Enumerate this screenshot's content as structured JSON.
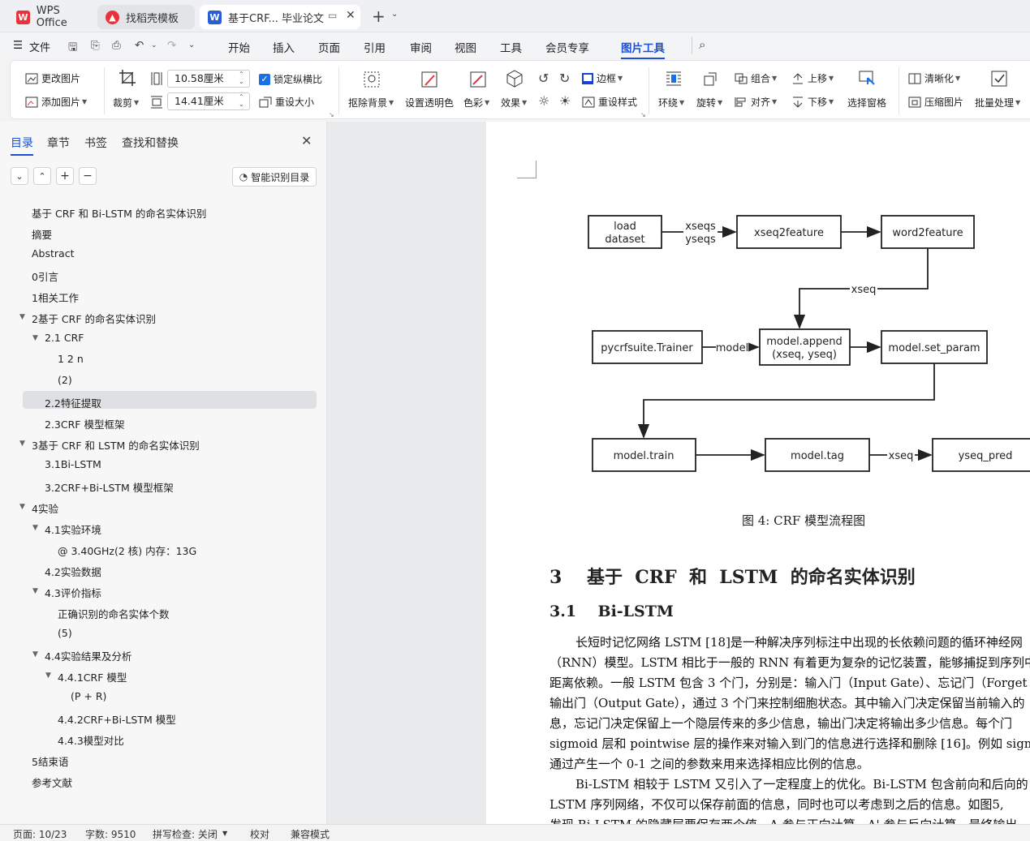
{
  "tabs": {
    "wps": "WPS Office",
    "template": "找稻壳模板",
    "doc": "基于CRF... 毕业论文"
  },
  "menu": {
    "file": "文件",
    "items": [
      "开始",
      "插入",
      "页面",
      "引用",
      "审阅",
      "视图",
      "工具",
      "会员专享",
      "图片工具"
    ]
  },
  "ribbon": {
    "change_image": "更改图片",
    "add_image": "添加图片",
    "crop": "裁剪",
    "width": "10.58厘米",
    "height": "14.41厘米",
    "lock_ratio": "锁定纵横比",
    "resize": "重设大小",
    "remove_bg": "抠除背景",
    "set_transparent": "设置透明色",
    "color": "色彩",
    "effect": "效果",
    "border": "边框",
    "reset_style": "重设样式",
    "wrap": "环绕",
    "rotate": "旋转",
    "group": "组合",
    "align": "对齐",
    "bring_up": "上移",
    "send_down": "下移",
    "select_pane": "选择窗格",
    "sharpen": "清晰化",
    "compress": "压缩图片",
    "batch": "批量处理"
  },
  "nav": {
    "tabs": [
      "目录",
      "章节",
      "书签",
      "查找和替换"
    ],
    "smart_toc": "智能识别目录",
    "items": [
      {
        "label": "基于 CRF 和 Bi-LSTM 的命名实体识别"
      },
      {
        "label": "摘要"
      },
      {
        "label": "Abstract"
      },
      {
        "label": "0引言"
      },
      {
        "label": "1相关工作"
      },
      {
        "label": "2基于 CRF 的命名实体识别"
      },
      {
        "label": "2.1 CRF"
      },
      {
        "label": "1 2 n"
      },
      {
        "label": "(2)"
      },
      {
        "label": "2.2特征提取"
      },
      {
        "label": "2.3CRF 模型框架"
      },
      {
        "label": "3基于 CRF 和 LSTM 的命名实体识别"
      },
      {
        "label": "3.1Bi-LSTM"
      },
      {
        "label": "3.2CRF+Bi-LSTM 模型框架"
      },
      {
        "label": "4实验"
      },
      {
        "label": "4.1实验环境"
      },
      {
        "label": "@ 3.40GHz(2 核) 内存：13G"
      },
      {
        "label": "4.2实验数据"
      },
      {
        "label": "4.3评价指标"
      },
      {
        "label": "正确识别的命名实体个数"
      },
      {
        "label": "(5)"
      },
      {
        "label": "4.4实验结果及分析"
      },
      {
        "label": "4.4.1CRF 模型"
      },
      {
        "label": "(P + R)"
      },
      {
        "label": "4.4.2CRF+Bi-LSTM 模型"
      },
      {
        "label": "4.4.3模型对比"
      },
      {
        "label": "5结束语"
      },
      {
        "label": "参考文献"
      }
    ]
  },
  "diagram": {
    "load": "load",
    "dataset": "dataset",
    "xseqs": "xseqs",
    "yseqs": "yseqs",
    "xseq2feature": "xseq2feature",
    "word2feature": "word2feature",
    "xseq": "xseq",
    "trainer": "pycrfsuite.Trainer",
    "model": "model",
    "append1": "model.append",
    "append2": "(xseq, yseq)",
    "set_param": "model.set_param",
    "train": "model.train",
    "tag": "model.tag",
    "xseq2": "xseq",
    "pred": "yseq_pred"
  },
  "document": {
    "caption": "图  4: CRF 模型流程图",
    "heading3": "3    基于  CRF  和  LSTM  的命名实体识别",
    "heading31": "3.1    Bi-LSTM",
    "p1": [
      "长短时记忆网络  LSTM [18]是一种解决序列标注中出现的长依赖问题的循环神经网",
      "（RNN）模型。LSTM 相比于一般的  RNN 有着更为复杂的记忆装置，能够捕捉到序列中",
      "距离依赖。一般  LSTM 包含  3 个门，分别是：输入门（Input Gate）、忘记门（Forget G",
      "输出门（Output Gate），通过  3 个门来控制细胞状态。其中输入门决定保留当前输入的",
      "息，忘记门决定保留上一个隐层传来的多少信息，输出门决定将输出多少信息。每个门",
      "sigmoid 层和  pointwise 层的操作来对输入到门的信息进行选择和删除  [16]。例如  sigm",
      "通过产生一个  0-1 之间的参数来用来选择相应比例的信息。"
    ],
    "p2": [
      "Bi-LSTM 相较于  LSTM 又引入了一定程度上的优化。Bi-LSTM 包含前向和后向的",
      "LSTM 序列网络，不仅可以保存前面的信息，同时也可以考虑到之后的信息。如图5,",
      "发现 Bi-LSTM 的隐藏层要保存两个值，A 参与正向计算，A' 参与反向计算，最终输出"
    ]
  },
  "status": {
    "page": "页面: 10/23",
    "words": "字数: 9510",
    "spell": "拼写检查: 关闭",
    "proof": "校对",
    "compat": "兼容模式"
  }
}
